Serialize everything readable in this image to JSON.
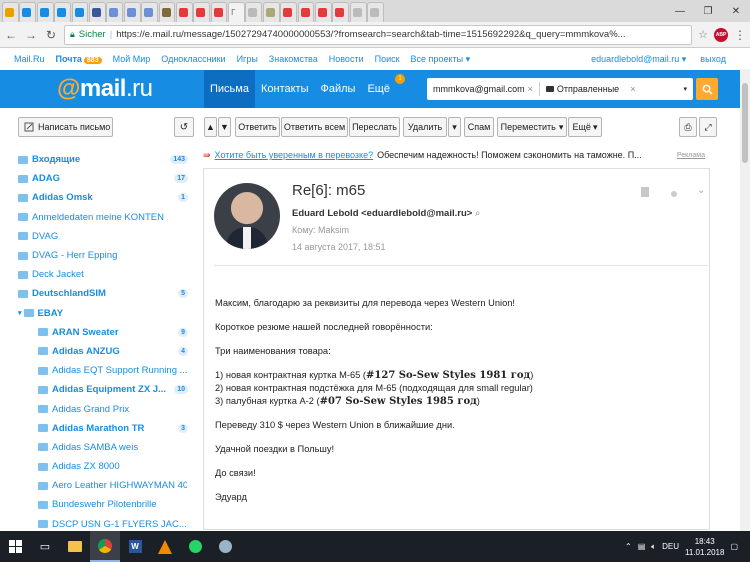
{
  "browser": {
    "tab_count": 22,
    "active_tab_index": 13,
    "active_tab_label": "Г",
    "address": {
      "secure_label": "Sicher",
      "url": "https://e.mail.ru/message/15027294740000000553/?fromsearch=search&tab-time=1515692292&q_query=mmmkova%..."
    }
  },
  "portal": {
    "links": [
      "Mail.Ru",
      "Почта",
      "Мой Мир",
      "Одноклассники",
      "Игры",
      "Знакомства",
      "Новости",
      "Поиск",
      "Все проекты ▾"
    ],
    "mail_badge": "883",
    "user": "eduardlebold@mail.ru ▾",
    "logout": "выход"
  },
  "header": {
    "logo_at": "@",
    "logo_text": "mail",
    "logo_ru": ".ru",
    "nav": [
      "Письма",
      "Контакты",
      "Файлы",
      "Ещё"
    ],
    "more_badge": "1",
    "search_chip_1": "mmmkova@gmail.com",
    "search_chip_2": "Отправленные"
  },
  "toolbar": {
    "compose": "Написать письмо",
    "reply": "Ответить",
    "reply_all": "Ответить всем",
    "forward": "Переслать",
    "delete": "Удалить",
    "spam": "Спам",
    "move": "Переместить",
    "more": "Ещё"
  },
  "folders": [
    {
      "label": "Входящие",
      "count": "143",
      "unread": true,
      "sub": false
    },
    {
      "label": "ADAG",
      "count": "17",
      "unread": true,
      "sub": false
    },
    {
      "label": "Adidas Omsk",
      "count": "1",
      "unread": true,
      "sub": false
    },
    {
      "label": "Anmeldedaten meine KONTEN",
      "count": "",
      "unread": false,
      "sub": false
    },
    {
      "label": "DVAG",
      "count": "",
      "unread": false,
      "sub": false
    },
    {
      "label": "DVAG - Herr Epping",
      "count": "",
      "unread": false,
      "sub": false
    },
    {
      "label": "Deck Jacket",
      "count": "",
      "unread": false,
      "sub": false
    },
    {
      "label": "DeutschlandSIM",
      "count": "5",
      "unread": true,
      "sub": false
    },
    {
      "label": "EBAY",
      "count": "",
      "unread": true,
      "sub": false,
      "expanded": true
    },
    {
      "label": "ARAN Sweater",
      "count": "9",
      "unread": true,
      "sub": true
    },
    {
      "label": "Adidas ANZUG",
      "count": "4",
      "unread": true,
      "sub": true
    },
    {
      "label": "Adidas EQT Support Running ...",
      "count": "",
      "unread": false,
      "sub": true
    },
    {
      "label": "Adidas Equipment ZX J...",
      "count": "10",
      "unread": true,
      "sub": true
    },
    {
      "label": "Adidas Grand Prix",
      "count": "",
      "unread": false,
      "sub": true
    },
    {
      "label": "Adidas Marathon TR",
      "count": "3",
      "unread": true,
      "sub": true
    },
    {
      "label": "Adidas SAMBA weis",
      "count": "",
      "unread": false,
      "sub": true
    },
    {
      "label": "Adidas ZX 8000",
      "count": "",
      "unread": false,
      "sub": true
    },
    {
      "label": "Aero Leather HIGHWAYMAN 40",
      "count": "",
      "unread": false,
      "sub": true
    },
    {
      "label": "Bundeswehr Pilotenbrille",
      "count": "",
      "unread": false,
      "sub": true
    },
    {
      "label": "DSCP USN G-1 FLYERS JAC...",
      "count": "",
      "unread": false,
      "sub": true
    }
  ],
  "ad": {
    "link": "Хотите быть уверенным в перевозке?",
    "text": "Обеспечим надежность! Поможем сэкономить на таможне. П...",
    "label": "Реклама"
  },
  "message": {
    "subject": "Re[6]: m65",
    "from": "Eduard Lebold <eduardlebold@mail.ru>",
    "to": "Кому: Maksim",
    "date": "14 августа 2017, 18:51",
    "greeting": "Максим, благодарю за реквизиты для перевода через Western Union!",
    "summary": "Короткое резюме нашей последней говорённости:",
    "items_title": "Три наименования товара:",
    "item1_pre": "1) новая контрактная куртка M-65 (",
    "item1_bold": "#127 So-Sew Styles 1981 год",
    "item1_post": ")",
    "item2": "2) новая контрактная подстёжка для M-65 (подходящая для small regular)",
    "item3_pre": "3) палубная куртка A-2 (",
    "item3_bold": "#07 So-Sew Styles 1985 год",
    "item3_post": ")",
    "transfer": "Переведу 310 $ через Western Union в ближайшие дни.",
    "wish": "Удачной поездки в Польшу!",
    "bye": "До связи!",
    "sign": "Эдуард"
  },
  "taskbar": {
    "lang": "DEU",
    "time": "18:43",
    "date": "11.01.2018"
  }
}
